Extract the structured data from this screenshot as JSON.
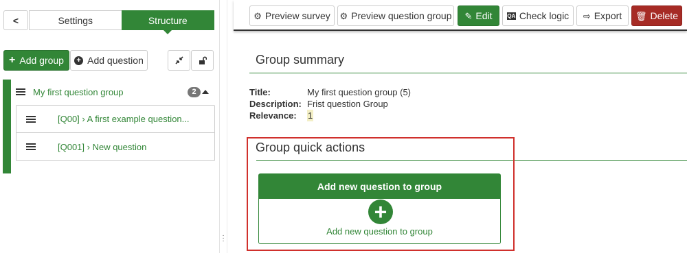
{
  "sidebar": {
    "back_label": "<",
    "tabs": [
      {
        "label": "Settings",
        "active": false
      },
      {
        "label": "Structure",
        "active": true
      }
    ],
    "add_group_label": "Add group",
    "add_question_label": "Add question",
    "group": {
      "label": "My first question group",
      "count": "2",
      "questions": [
        {
          "label": "[Q00] › A first example question..."
        },
        {
          "label": "[Q001] › New question"
        }
      ]
    }
  },
  "toolbar": {
    "preview_survey": "Preview survey",
    "preview_group": "Preview question group",
    "edit": "Edit",
    "check_logic": "Check logic",
    "export": "Export",
    "delete": "Delete"
  },
  "summary": {
    "title": "Group summary",
    "rows": [
      {
        "key": "Title:",
        "value": "My first question group (5)"
      },
      {
        "key": "Description:",
        "value": "Frist question Group"
      },
      {
        "key": "Relevance:",
        "value": "1"
      }
    ]
  },
  "quick_actions": {
    "title": "Group quick actions",
    "card_header": "Add new question to group",
    "card_link": "Add new question to group"
  },
  "colors": {
    "accent": "#328637",
    "danger": "#a62b25",
    "highlight": "#d0302c"
  },
  "icons": [
    "back-icon",
    "plus-icon",
    "plus-circle-icon",
    "collapse-icon",
    "unlock-icon",
    "drag-handle-icon",
    "gear-icon",
    "pencil-icon",
    "check-logic-icon",
    "export-icon",
    "trash-icon"
  ]
}
